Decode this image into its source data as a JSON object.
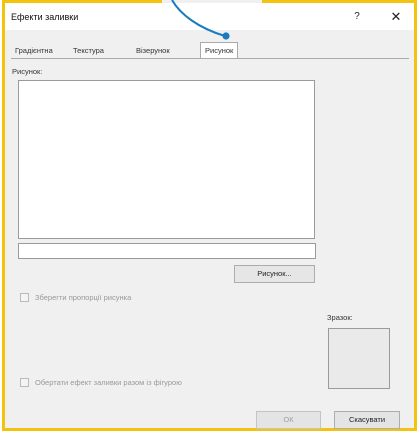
{
  "window": {
    "title": "Ефекти заливки"
  },
  "title_buttons": {
    "help": "?",
    "close": "✕"
  },
  "tabs": [
    {
      "label": "Градієнтна"
    },
    {
      "label": "Текстура"
    },
    {
      "label": "Візерунок"
    },
    {
      "label": "Рисунок"
    }
  ],
  "active_tab": "Рисунок",
  "picture": {
    "section_label": "Рисунок:",
    "path_value": "",
    "select_button": "Рисунок..."
  },
  "options": {
    "keep_proportions": "Зберегти пропорції рисунка",
    "rotate_with_shape": "Обертати ефект заливки разом із фігурою"
  },
  "sample": {
    "label": "Зразок:"
  },
  "footer": {
    "ok": "ОК",
    "cancel": "Скасувати"
  },
  "colors": {
    "frame_highlight": "#f2c40f",
    "pointer": "#1a7bbf"
  },
  "icons": {
    "close": "close-icon",
    "help": "help-icon"
  }
}
